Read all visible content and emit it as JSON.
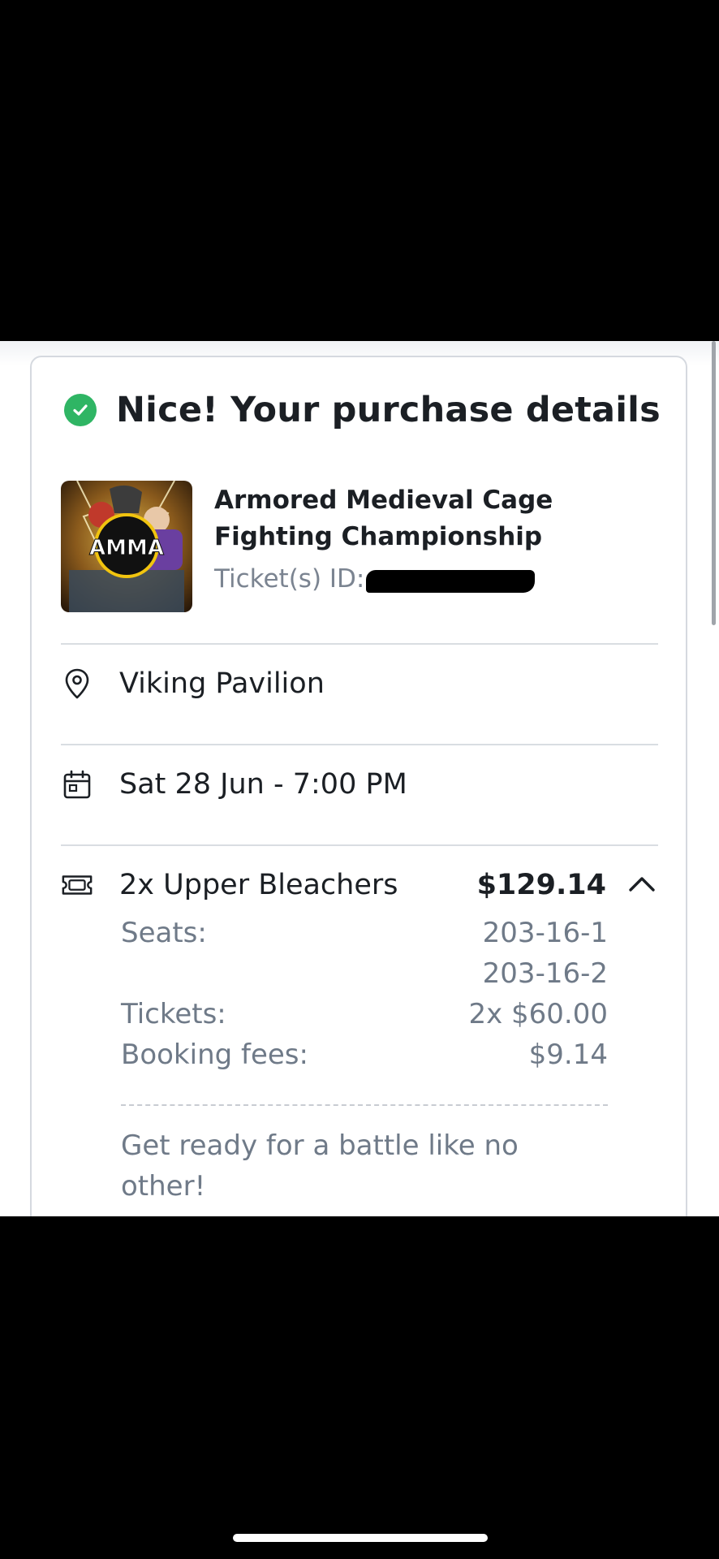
{
  "header": {
    "title": "Nice! Your purchase details"
  },
  "event": {
    "title": "Armored Medieval Cage Fighting Championship",
    "ticket_id_label": "Ticket(s) ID:",
    "thumb_logo_text": "AMMA"
  },
  "venue": {
    "name": "Viking Pavilion",
    "icon": "map-pin-icon"
  },
  "date": {
    "text": "Sat 28 Jun - 7:00 PM",
    "icon": "calendar-icon"
  },
  "tickets": {
    "summary": "2x Upper Bleachers",
    "total": "$129.14",
    "icon": "ticket-icon",
    "details": {
      "seats_label": "Seats:",
      "seats": [
        "203-16-1",
        "203-16-2"
      ],
      "tickets_label": "Tickets:",
      "tickets_value": "2x $60.00",
      "fees_label": "Booking fees:",
      "fees_value": "$9.14"
    },
    "note": "Get ready for a battle like no other!"
  },
  "colors": {
    "success_green": "#2fb564",
    "text_dark": "#1b1f24",
    "text_muted": "#6f7a88"
  }
}
